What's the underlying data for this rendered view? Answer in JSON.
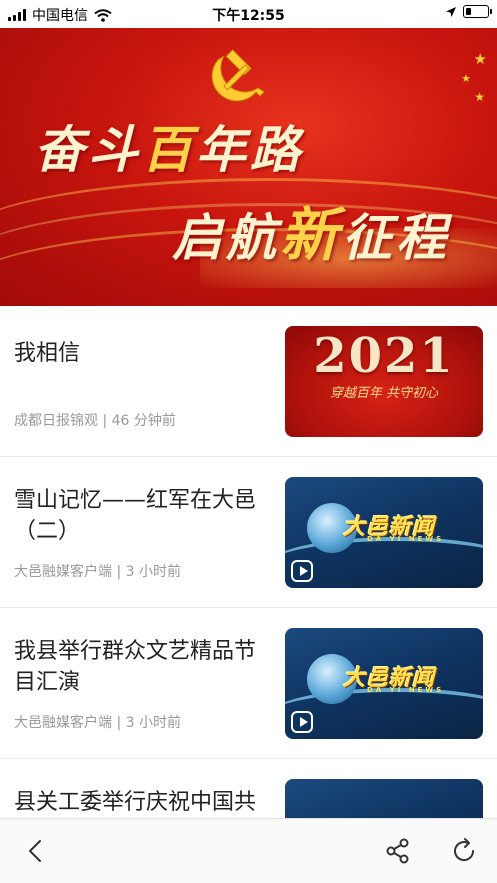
{
  "status_bar": {
    "carrier": "中国电信",
    "time": "下午12:55",
    "icons": [
      "signal-icon",
      "wifi-icon",
      "location-arrow-icon",
      "battery-icon"
    ]
  },
  "banner": {
    "line1": {
      "a": "奋斗",
      "b": "百",
      "c": "年路"
    },
    "line2": {
      "a": "启航",
      "b": "新",
      "c": "征程"
    },
    "colors": {
      "background": "#c8150e",
      "text": "#fff3cf",
      "highlight": "#ffd24a"
    }
  },
  "news": [
    {
      "title": "我相信",
      "meta": "成都日报锦观 | 46 分钟前",
      "thumb": {
        "type": "red",
        "year": "2021",
        "slogan": "穿越百年 共守初心"
      }
    },
    {
      "title": "雪山记忆——红军在大邑（二）",
      "meta": "大邑融媒客户端 | 3 小时前",
      "thumb": {
        "type": "blue",
        "logo": "大邑新闻",
        "pinyin": "DA YI NEWS"
      }
    },
    {
      "title": "我县举行群众文艺精品节目汇演",
      "meta": "大邑融媒客户端 | 3 小时前",
      "thumb": {
        "type": "blue",
        "logo": "大邑新闻",
        "pinyin": "DA YI NEWS"
      }
    },
    {
      "title": "县关工委举行庆祝中国共",
      "meta": "",
      "thumb": {
        "type": "blue",
        "logo": "",
        "pinyin": ""
      }
    }
  ],
  "toolbar": {
    "icons": [
      "back-arrow-icon",
      "share-icon",
      "refresh-icon"
    ]
  },
  "colors": {
    "accent_red": "#c8150e",
    "meta_gray": "#9a9a9a",
    "logo_yellow": "#ffe34d"
  }
}
